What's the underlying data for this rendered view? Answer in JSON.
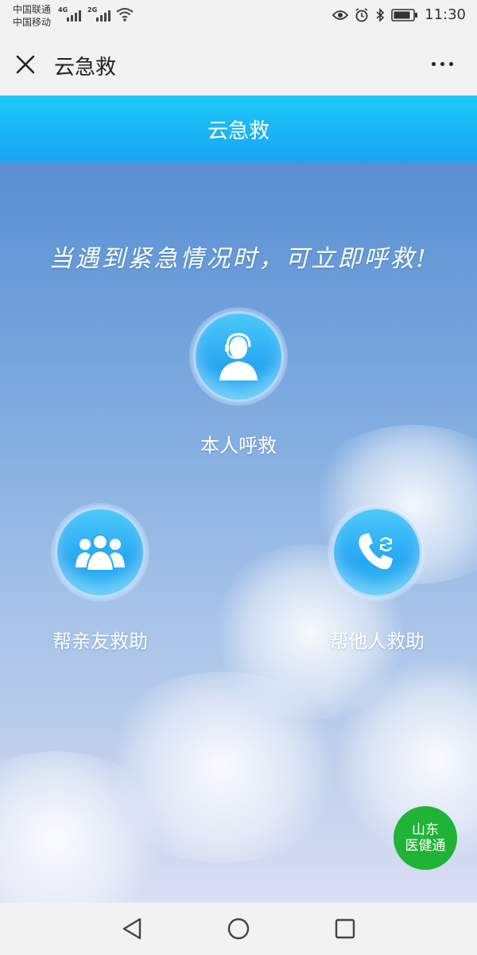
{
  "status_bar": {
    "carrier_1": "中国联通",
    "carrier_2": "中国移动",
    "net_1": "4G",
    "net_2": "2G",
    "time": "11:30"
  },
  "title_bar": {
    "title": "云急救"
  },
  "header": {
    "title": "云急救"
  },
  "main": {
    "slogan": "当遇到紧急情况时，可立即呼救!",
    "actions": [
      {
        "label": "本人呼救",
        "icon": "operator-headset-icon"
      },
      {
        "label": "帮亲友救助",
        "icon": "group-people-icon"
      },
      {
        "label": "帮他人救助",
        "icon": "phone-transfer-icon"
      }
    ]
  },
  "badge": {
    "line1": "山东",
    "line2": "医健通",
    "color": "#1fb436"
  },
  "colors": {
    "header_top": "#1cc9f9",
    "header_bottom": "#1aa4f3",
    "button_blue": "#27a6f3"
  }
}
